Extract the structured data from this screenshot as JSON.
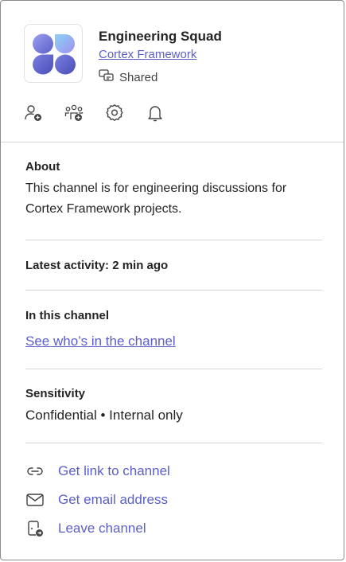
{
  "team": {
    "name": "Engineering Squad",
    "parent": "Cortex Framework",
    "shared_label": "Shared",
    "logo_colors": {
      "primary": "#5b5fc7",
      "secondary": "#8b8fe8",
      "accent": "#8cd3f5"
    }
  },
  "actions": [
    {
      "icon": "add-person-icon"
    },
    {
      "icon": "add-group-icon"
    },
    {
      "icon": "gear-icon"
    },
    {
      "icon": "bell-icon"
    }
  ],
  "about": {
    "label": "About",
    "description": "This channel is for engineering discussions for Cortex Framework projects."
  },
  "activity": {
    "label": "Latest activity: 2 min ago"
  },
  "members": {
    "label": "In this channel",
    "link": "See who’s in the channel"
  },
  "sensitivity": {
    "label": "Sensitivity",
    "value": "Confidential • Internal only"
  },
  "menu": {
    "get_link": "Get link to channel",
    "get_email": "Get email address",
    "leave": "Leave channel"
  },
  "colors": {
    "link": "#5b5fc7",
    "text": "#242424",
    "divider": "#d6d6d6"
  }
}
